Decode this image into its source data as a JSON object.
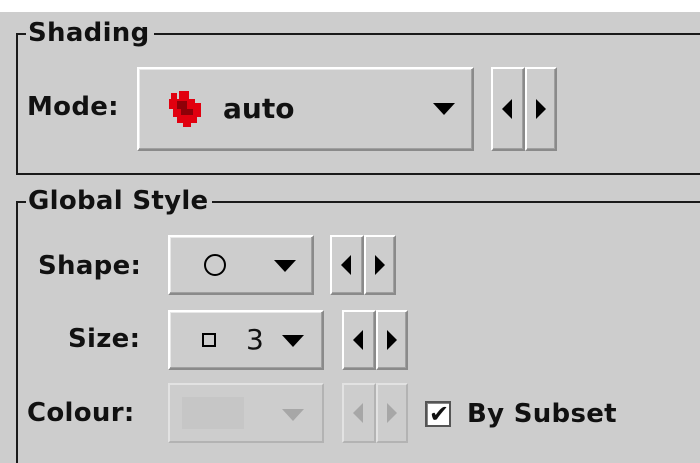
{
  "shading": {
    "title": "Shading",
    "mode_label": "Mode:",
    "mode_value": "auto",
    "mode_icon": "red-density-blob-icon"
  },
  "global_style": {
    "title": "Global Style",
    "shape_label": "Shape:",
    "shape_icon": "open-circle-icon",
    "size_label": "Size:",
    "size_icon": "open-square-icon",
    "size_value": "3",
    "colour_label": "Colour:",
    "colour_enabled": false,
    "by_subset_label": "By Subset",
    "by_subset_checked": true
  },
  "colors": {
    "panel": "#cdcdcd",
    "mode_icon": "#e1000f"
  }
}
